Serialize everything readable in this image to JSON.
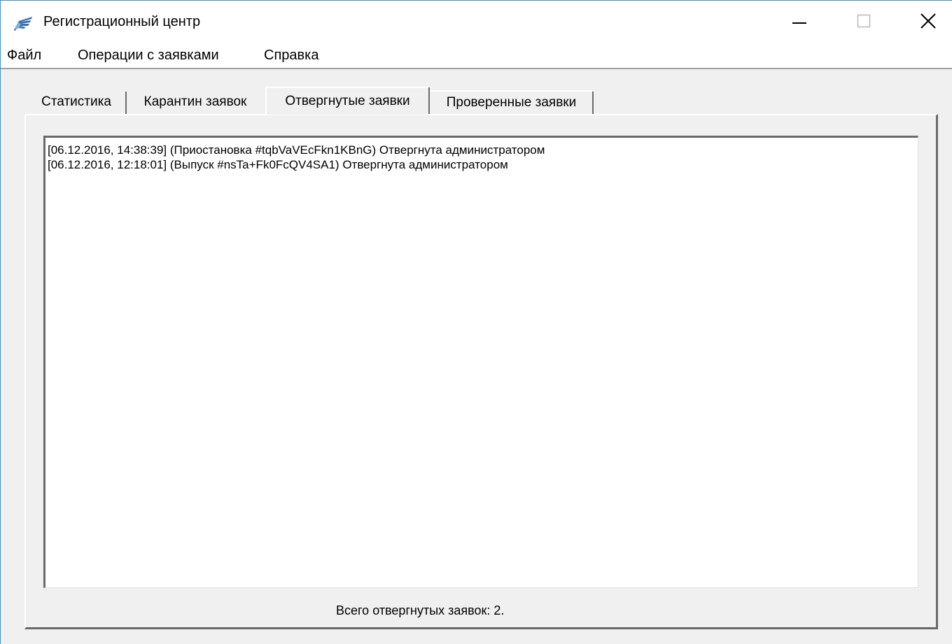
{
  "window": {
    "title": "Регистрационный центр",
    "icon": "wing-app-icon",
    "controls": {
      "minimize_icon": "minimize-icon",
      "maximize_icon": "maximize-icon",
      "close_icon": "close-icon"
    }
  },
  "menu": {
    "items": [
      {
        "label": "Файл"
      },
      {
        "label": "Операции с заявками"
      },
      {
        "label": "Справка"
      }
    ]
  },
  "tabs": [
    {
      "label": "Статистика",
      "active": false
    },
    {
      "label": "Карантин заявок",
      "active": false
    },
    {
      "label": "Отвергнутые заявки",
      "active": true
    },
    {
      "label": "Проверенные заявки",
      "active": false
    }
  ],
  "list": {
    "items": [
      {
        "text": "[06.12.2016, 14:38:39] (Приостановка #tqbVaVEcFkn1KBnG) Отвергнута администратором"
      },
      {
        "text": "[06.12.2016, 12:18:01] (Выпуск #nsTa+Fk0FcQV4SA1) Отвергнута администратором"
      }
    ]
  },
  "status": {
    "text": "Всего отвергнутых заявок: 2."
  },
  "colors": {
    "window_border": "#3b8fd9",
    "face": "#f0f0f0",
    "icon_blue": "#3a6fb0"
  }
}
